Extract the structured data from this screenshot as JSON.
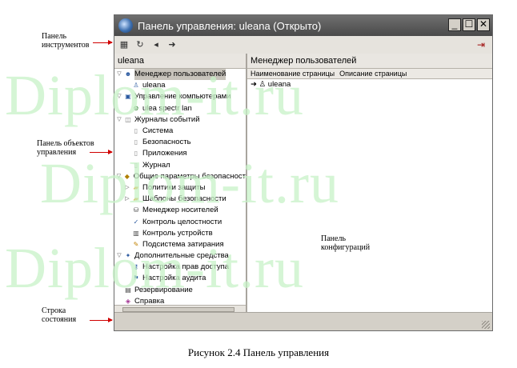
{
  "watermark": "Diplom-it.ru",
  "window": {
    "title": "Панель управления: uleana (Открыто)",
    "buttons": {
      "minimize": "_",
      "maximize": "☐",
      "close": "✕"
    }
  },
  "toolbar": {
    "icons": [
      "grid-icon",
      "refresh-icon",
      "back-icon",
      "forward-icon"
    ],
    "exit_icon": "exit-icon"
  },
  "left_pane": {
    "header": "uleana",
    "tree": [
      {
        "label": "Менеджер пользователей",
        "level": 0,
        "expander": "▽",
        "icon": "users-icon",
        "selected": true
      },
      {
        "label": "uleana",
        "level": 1,
        "expander": "",
        "icon": "user-icon"
      },
      {
        "label": "Управление компьютерами",
        "level": 0,
        "expander": "▽",
        "icon": "computers-icon"
      },
      {
        "label": "ulea spectr lan",
        "level": 1,
        "expander": "",
        "icon": "network-icon"
      },
      {
        "label": "Журналы событий",
        "level": 0,
        "expander": "▽",
        "icon": "journal-icon"
      },
      {
        "label": "Система",
        "level": 1,
        "expander": "",
        "icon": "page-icon"
      },
      {
        "label": "Безопасность",
        "level": 1,
        "expander": "",
        "icon": "page-icon"
      },
      {
        "label": "Приложения",
        "level": 1,
        "expander": "",
        "icon": "page-icon"
      },
      {
        "label": "Журнал",
        "level": 1,
        "expander": "",
        "icon": "page-icon"
      },
      {
        "label": "Общие параметры безопасност",
        "level": 0,
        "expander": "▽",
        "icon": "security-icon"
      },
      {
        "label": "Политики защиты",
        "level": 1,
        "expander": "▷",
        "icon": "folder-icon"
      },
      {
        "label": "Шаблоны безопасности",
        "level": 1,
        "expander": "▷",
        "icon": "folder-icon"
      },
      {
        "label": "Менеджер носителей",
        "level": 1,
        "expander": "",
        "icon": "media-icon"
      },
      {
        "label": "Контроль целостности",
        "level": 1,
        "expander": "",
        "icon": "integrity-icon"
      },
      {
        "label": "Контроль устройств",
        "level": 1,
        "expander": "",
        "icon": "device-icon"
      },
      {
        "label": "Подсистема затирания",
        "level": 1,
        "expander": "",
        "icon": "erase-icon"
      },
      {
        "label": "Дополнительные средства",
        "level": 0,
        "expander": "▽",
        "icon": "tools-icon"
      },
      {
        "label": "Настройка прав доступа",
        "level": 1,
        "expander": "",
        "icon": "access-icon"
      },
      {
        "label": "Настройка аудита",
        "level": 1,
        "expander": "",
        "icon": "audit-icon"
      },
      {
        "label": "Резервирование",
        "level": 0,
        "expander": "",
        "icon": "backup-icon"
      },
      {
        "label": "Справка",
        "level": 0,
        "expander": "",
        "icon": "help-icon"
      }
    ]
  },
  "right_pane": {
    "header": "Менеджер пользователей",
    "columns": [
      "Наименование страницы",
      "Описание страницы"
    ],
    "rows": [
      {
        "label": "uleana"
      }
    ]
  },
  "annotations": {
    "toolbar": "Панель\nинструментов",
    "objects": "Панель объектов\nуправления",
    "config": "Панель\nконфигураций",
    "status": "Строка\nсостояния"
  },
  "caption": "Рисунок 2.4 Панель управления"
}
